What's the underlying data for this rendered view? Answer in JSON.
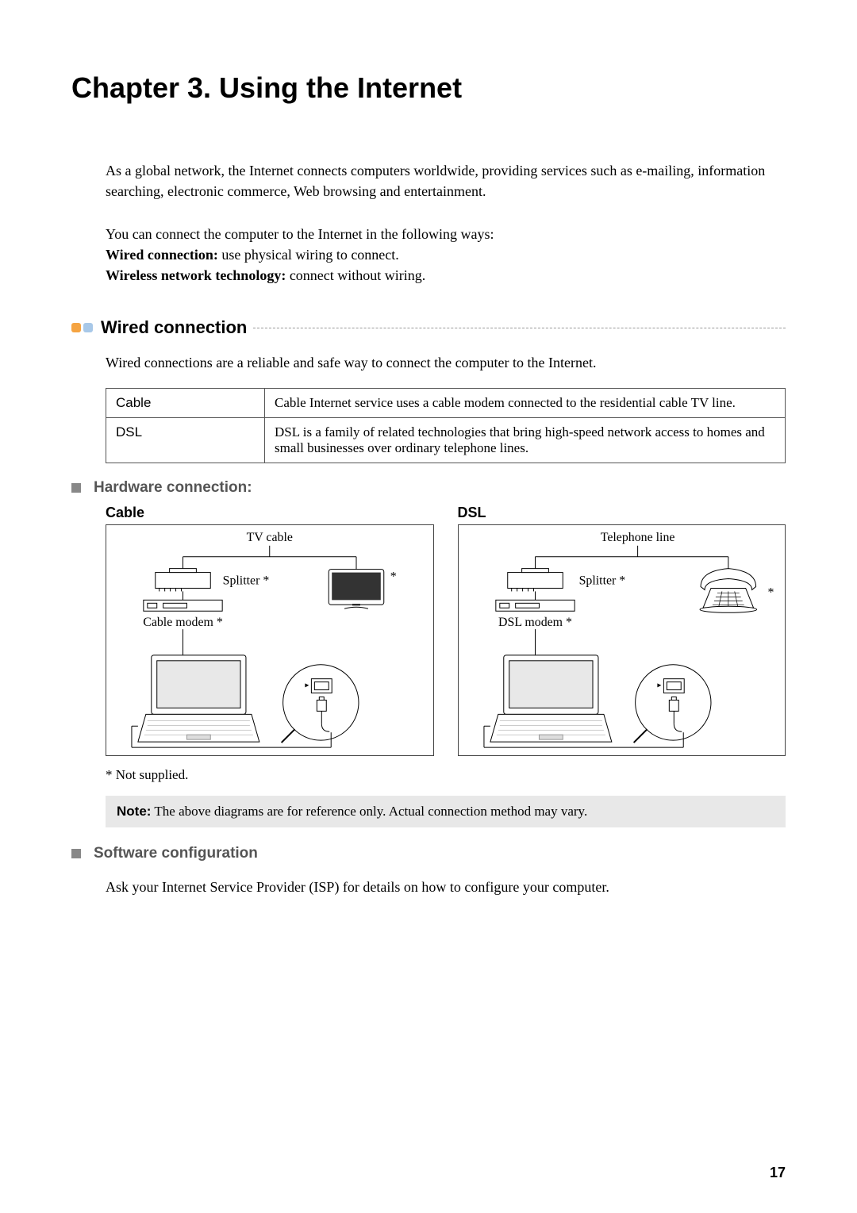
{
  "chapter": {
    "title": "Chapter 3. Using the Internet"
  },
  "intro": {
    "p1": "As a global network, the Internet connects computers worldwide, providing services such as e-mailing, information searching, electronic commerce, Web browsing and entertainment.",
    "p2": "You can connect the computer to the Internet in the following ways:",
    "wired_label": "Wired connection:",
    "wired_text": " use physical wiring to connect.",
    "wireless_label": "Wireless network technology:",
    "wireless_text": " connect without wiring."
  },
  "section_wired": {
    "title": "Wired connection",
    "desc": "Wired connections are a reliable and safe way to connect the computer to the Internet.",
    "table": [
      {
        "name": "Cable",
        "desc": "Cable Internet service uses a cable modem connected to the residential cable TV line."
      },
      {
        "name": "DSL",
        "desc": "DSL is a family of related technologies that bring high-speed network access to homes and small businesses over ordinary telephone lines."
      }
    ]
  },
  "hardware": {
    "title": "Hardware connection:",
    "cable": {
      "title": "Cable",
      "labels": {
        "source": "TV cable",
        "splitter": "Splitter *",
        "modem": "Cable modem *"
      }
    },
    "dsl": {
      "title": "DSL",
      "labels": {
        "source": "Telephone line",
        "splitter": "Splitter *",
        "modem": "DSL modem *"
      }
    },
    "footnote": "* Not supplied.",
    "note_label": "Note:",
    "note_text": " The above diagrams are for reference only. Actual connection method may vary."
  },
  "software": {
    "title": "Software configuration",
    "text": "Ask your Internet Service Provider (ISP) for details on how to configure your computer."
  },
  "page_number": "17"
}
